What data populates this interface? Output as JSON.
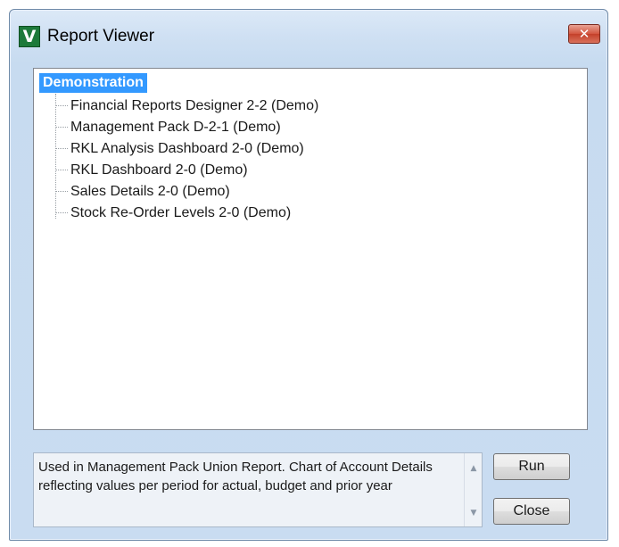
{
  "window": {
    "title": "Report Viewer",
    "icon_letter": "V",
    "close_glyph": "✕"
  },
  "tree": {
    "root": "Demonstration",
    "items": [
      {
        "label": "Financial Reports Designer 2-2 (Demo)"
      },
      {
        "label": "Management Pack D-2-1 (Demo)"
      },
      {
        "label": "RKL Analysis Dashboard 2-0 (Demo)"
      },
      {
        "label": "RKL Dashboard 2-0 (Demo)"
      },
      {
        "label": "Sales Details 2-0 (Demo)"
      },
      {
        "label": "Stock Re-Order Levels 2-0 (Demo)"
      }
    ]
  },
  "description": {
    "text": "Used in Management Pack Union Report. Chart of Account Details reflecting values per period for actual, budget and prior year",
    "scroll_up": "▲",
    "scroll_down": "▼"
  },
  "buttons": {
    "run": "Run",
    "close": "Close"
  },
  "icons": {
    "app": "report-viewer-app-icon",
    "close": "close-icon",
    "scroll_up": "scroll-up-arrow-icon",
    "scroll_down": "scroll-down-arrow-icon"
  },
  "colors": {
    "selection": "#3399ff",
    "close_button": "#c4402a",
    "app_icon": "#1d7a3a"
  }
}
